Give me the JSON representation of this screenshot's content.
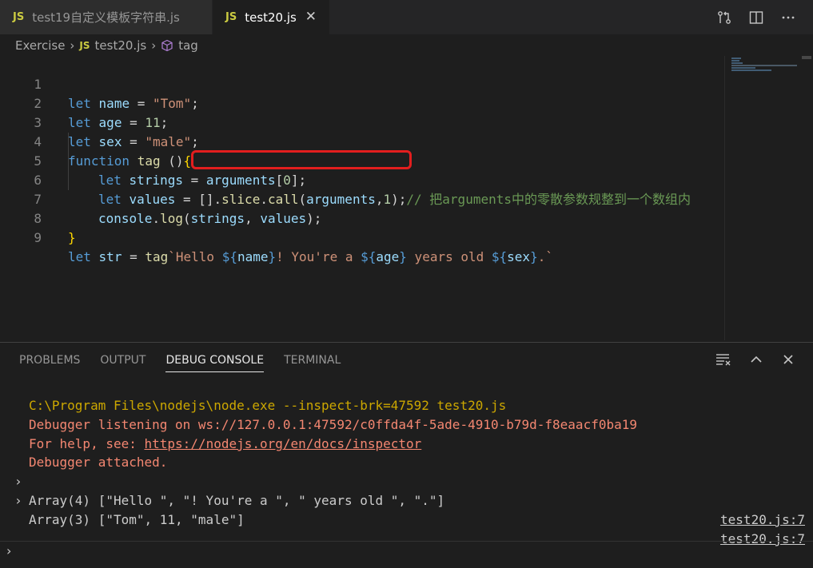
{
  "tabs": [
    {
      "badge": "JS",
      "label": "test19自定义模板字符串.js"
    },
    {
      "badge": "JS",
      "label": "test20.js",
      "close": "✕"
    }
  ],
  "breadcrumb": {
    "folder": "Exercise",
    "sep": "›",
    "badge": "JS",
    "file": "test20.js",
    "symbol": "tag"
  },
  "editor": {
    "line_numbers": [
      "1",
      "2",
      "3",
      "4",
      "5",
      "6",
      "7",
      "8",
      "9"
    ],
    "lines": [
      {
        "kw": "let",
        "name": "name",
        "op": " = ",
        "str": "\"Tom\"",
        "end": ";"
      },
      {
        "kw": "let",
        "name": "age",
        "op": " = ",
        "num": "11",
        "end": ";"
      },
      {
        "kw": "let",
        "name": "sex",
        "op": " = ",
        "str": "\"male\"",
        "end": ";"
      },
      {
        "kw": "function",
        "fn": "tag",
        "rest": " ()",
        "brace": "{"
      },
      {
        "kw": "let",
        "name": "strings",
        "op": " = ",
        "arg": "arguments",
        "idx_open": "[",
        "idx": "0",
        "idx_close": "];"
      },
      {
        "kw": "let",
        "name": "values",
        "op": " = ",
        "p1": "[].",
        "slice": "slice",
        "p2": ".",
        "call": "call",
        "p3": "(",
        "arg": "arguments",
        "p4": ",",
        "num": "1",
        "p5": ");",
        "comment": "// 把arguments中的零散参数规整到一个数组内"
      },
      {
        "obj": "console",
        "dot": ".",
        "log": "log",
        "open": "(",
        "a": "strings",
        "comma": ", ",
        "b": "values",
        "close": ");"
      },
      {
        "brace": "}"
      },
      {
        "kw": "let",
        "name": "str",
        "op": " = ",
        "fn": "tag",
        "t1": "`Hello ",
        "d1": "${",
        "v1": "name",
        "e1": "}",
        "t2": "! You're a ",
        "d2": "${",
        "v2": "age",
        "e2": "}",
        "t3": " years old ",
        "d3": "${",
        "v3": "sex",
        "e3": "}",
        "t4": ".`"
      }
    ]
  },
  "panel": {
    "tabs": [
      "PROBLEMS",
      "OUTPUT",
      "DEBUG CONSOLE",
      "TERMINAL"
    ],
    "active_tab": "DEBUG CONSOLE",
    "output": [
      {
        "text": "C:\\Program Files\\nodejs\\node.exe --inspect-brk=47592 test20.js"
      },
      {
        "text": "Debugger listening on ws://127.0.0.1:47592/c0ffda4f-5ade-4910-b79d-f8eaacf0ba19"
      },
      {
        "prefix": "For help, see: ",
        "link": "https://nodejs.org/en/docs/inspector"
      },
      {
        "text": "Debugger attached."
      },
      {
        "chev": "›",
        "text": "Array(4) [\"Hello \", \"! You're a \", \" years old \", \".\"]",
        "src": "test20.js:7"
      },
      {
        "chev": "›",
        "text": "Array(3) [\"Tom\", 11, \"male\"]",
        "src": "test20.js:7"
      }
    ],
    "repl_prompt": "›"
  },
  "colors": {
    "keyword": "#569cd6",
    "string": "#ce9178",
    "number": "#b5cea8",
    "function": "#dcdcaa",
    "variable": "#9cdcfe",
    "comment": "#6a9955",
    "highlight_box": "#e31e1e"
  }
}
